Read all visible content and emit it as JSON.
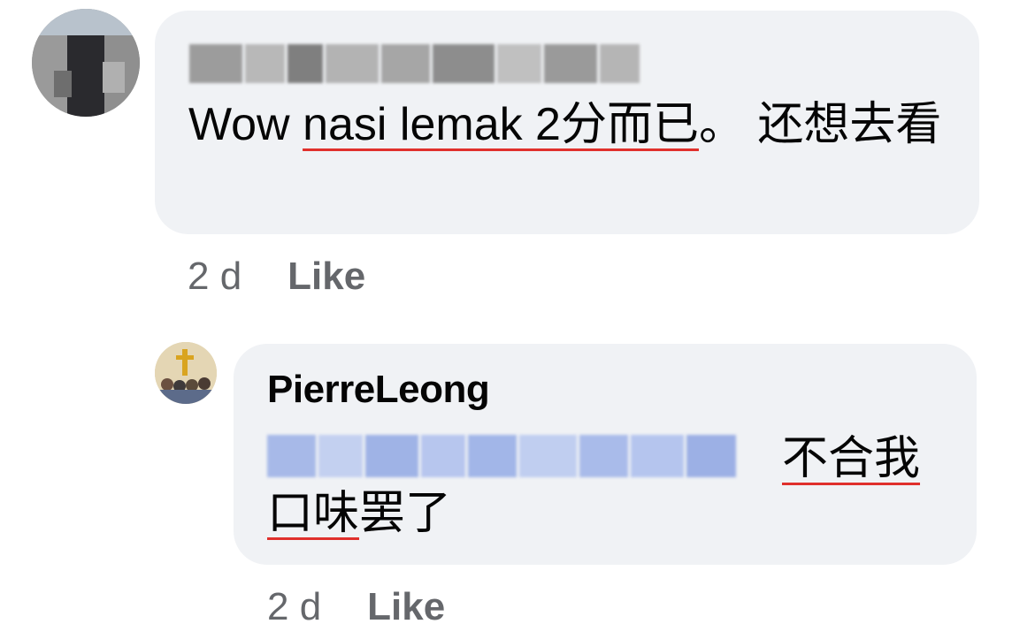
{
  "comments": [
    {
      "author_name_visible": false,
      "text_parts": [
        {
          "text": "Wow ",
          "underline": false
        },
        {
          "text": "nasi lemak 2分而已",
          "underline": true
        },
        {
          "text": "。 还想去看",
          "underline": false
        }
      ],
      "time": "2 d",
      "like_label": "Like"
    },
    {
      "author_name": "PierreLeong",
      "text_parts": [
        {
          "text": "不合我口味",
          "underline": true
        },
        {
          "text": "罢了",
          "underline": false
        }
      ],
      "time": "2 d",
      "like_label": "Like"
    }
  ],
  "colors": {
    "bubble": "#f0f2f5",
    "meta": "#65676b",
    "mention": "#1877f2",
    "spell_underline": "#e0302c"
  }
}
